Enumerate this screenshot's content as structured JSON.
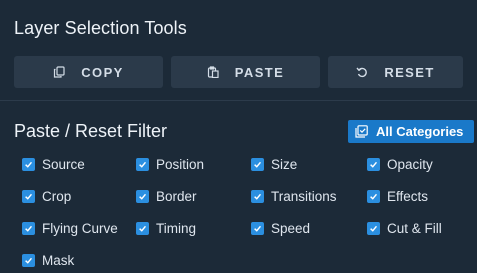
{
  "header": {
    "title": "Layer Selection Tools"
  },
  "toolbar": {
    "copy_label": "COPY",
    "paste_label": "PASTE",
    "reset_label": "RESET"
  },
  "filter": {
    "title": "Paste / Reset Filter",
    "all_categories_label": "All Categories",
    "items": [
      {
        "label": "Source",
        "checked": true
      },
      {
        "label": "Position",
        "checked": true
      },
      {
        "label": "Size",
        "checked": true
      },
      {
        "label": "Opacity",
        "checked": true
      },
      {
        "label": "Crop",
        "checked": true
      },
      {
        "label": "Border",
        "checked": true
      },
      {
        "label": "Transitions",
        "checked": true
      },
      {
        "label": "Effects",
        "checked": true
      },
      {
        "label": "Flying Curve",
        "checked": true
      },
      {
        "label": "Timing",
        "checked": true
      },
      {
        "label": "Speed",
        "checked": true
      },
      {
        "label": "Cut & Fill",
        "checked": true
      },
      {
        "label": "Mask",
        "checked": true
      }
    ]
  },
  "icons": {
    "copy": "copy-icon",
    "paste": "paste-icon",
    "reset": "reset-icon",
    "all_categories": "select-all-icon",
    "checkbox": "checkmark-icon"
  },
  "colors": {
    "background": "#1c2a38",
    "button": "#2b3a4a",
    "accent": "#1a79c9",
    "checkbox": "#2b8fe0"
  }
}
